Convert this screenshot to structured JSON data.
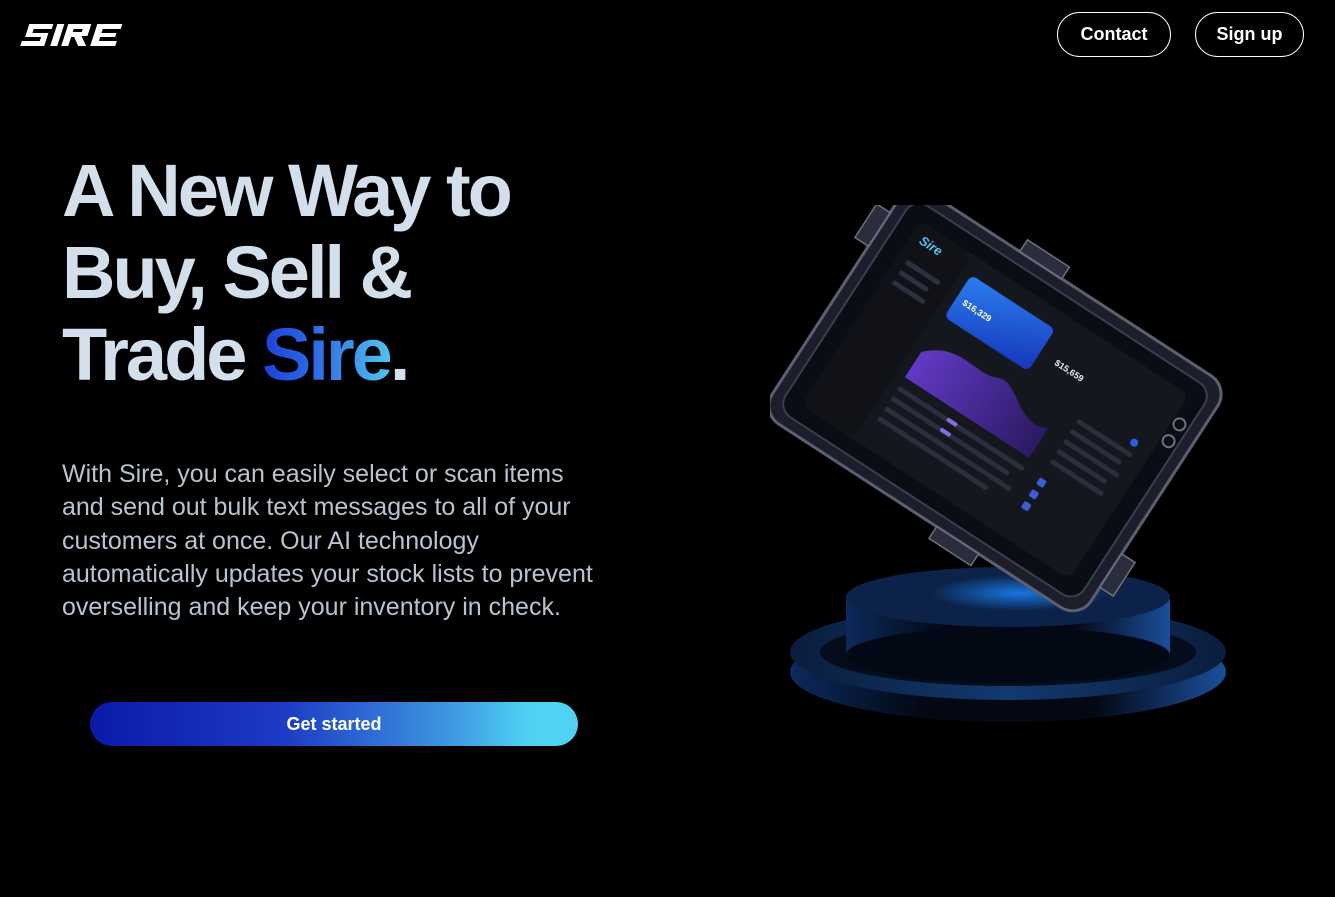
{
  "header": {
    "logo_text": "SIRE",
    "contact_label": "Contact",
    "signup_label": "Sign up"
  },
  "hero": {
    "headline_line1": "A New Way to",
    "headline_line2": "Buy, Sell &",
    "headline_line3_prefix": "Trade ",
    "headline_brand": "Sire",
    "headline_period": ".",
    "description": "With Sire, you can easily select or scan items and send out bulk text messages to all of your customers at once. Our AI technology automatically updates your stock lists to prevent overselling and keep your inventory in check.",
    "cta_label": "Get started"
  },
  "device_screen": {
    "brand": "Sire",
    "card_amount_1": "$16,329",
    "card_amount_2": "$15,659"
  },
  "colors": {
    "background": "#000000",
    "headline": "#d4dfec",
    "brand_gradient_start": "#1f3fd8",
    "brand_gradient_end": "#4fc3f0",
    "cta_gradient_start": "#0a1aa8",
    "cta_gradient_end": "#4fd3f2"
  }
}
